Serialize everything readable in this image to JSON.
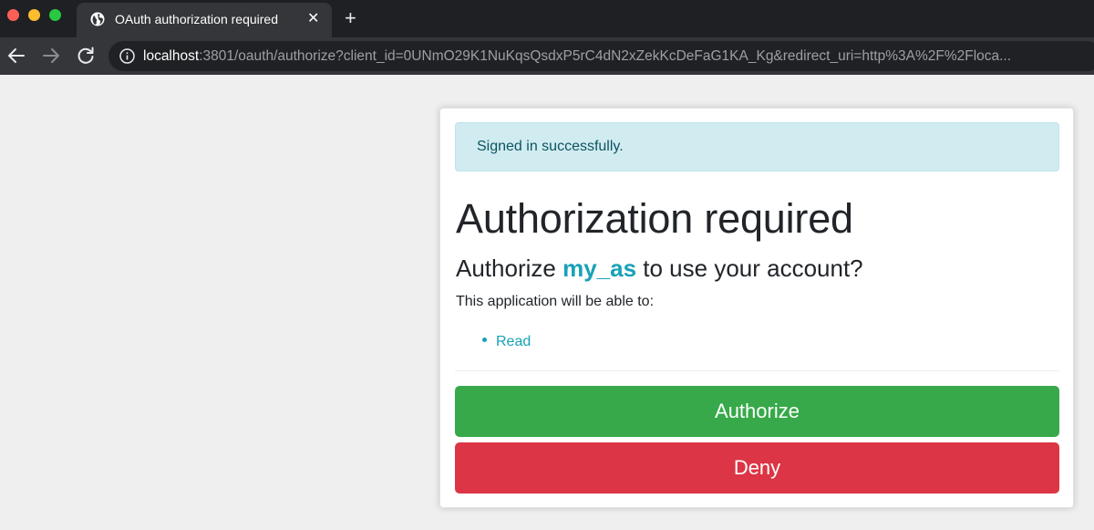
{
  "browser": {
    "tab_title": "OAuth authorization required",
    "tab_close": "✕",
    "new_tab": "+",
    "url_host": "localhost",
    "url_rest": ":3801/oauth/authorize?client_id=0UNmO29K1NuKqsQsdxP5rC4dN2xZekKcDeFaG1KA_Kg&redirect_uri=http%3A%2F%2Floca..."
  },
  "alert": {
    "text": "Signed in successfully."
  },
  "page": {
    "title": "Authorization required",
    "question_prefix": "Authorize ",
    "app_name": "my_as",
    "question_suffix": " to use your account?",
    "description": "This application will be able to:",
    "scopes": [
      "Read"
    ]
  },
  "actions": {
    "authorize_label": "Authorize",
    "deny_label": "Deny"
  },
  "colors": {
    "authorize": "#37a94a",
    "deny": "#dc3545",
    "accent": "#17a2b8",
    "alert_bg": "#d1ecf1"
  }
}
